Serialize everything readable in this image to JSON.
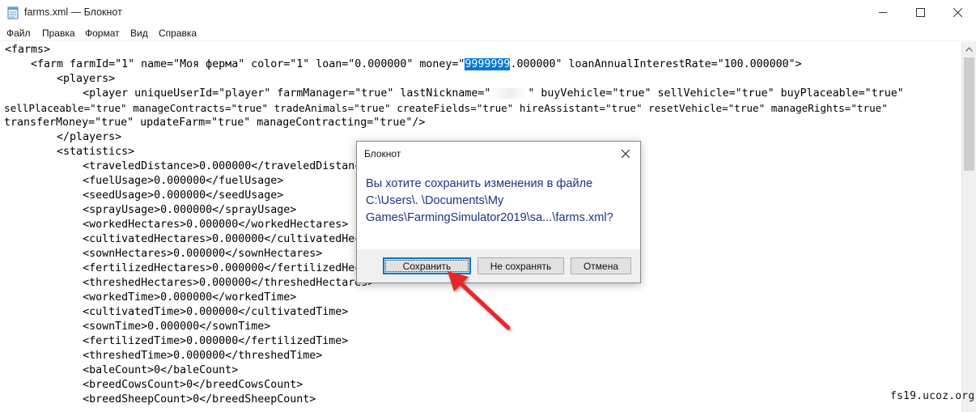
{
  "window": {
    "title": "farms.xml — Блокнот",
    "icon": "notepad-icon",
    "controls": [
      "minimize-icon",
      "maximize-icon",
      "close-icon"
    ]
  },
  "menu": [
    "Файл",
    "Правка",
    "Формат",
    "Вид",
    "Справка"
  ],
  "editor": {
    "lines": [
      "<farms>",
      "    <farm farmId=\"1\" name=\"Моя ферма\" color=\"1\" loan=\"0.000000\" money=\"",
      "        <players>",
      "            <player uniqueUserId=\"player\" farmManager=\"true\" lastNickname=\"",
      "sellPlaceable=\"true\" manageContracts=\"true\" tradeAnimals=\"true\" createFields=\"true\" hireAssistant=\"true\" resetVehicle=\"true\" manageRights=\"true\"",
      "transferMoney=\"true\" updateFarm=\"true\" manageContracting=\"true\"/>",
      "        </players>",
      "        <statistics>",
      "            <traveledDistance>0.000000</traveledDistance>",
      "            <fuelUsage>0.000000</fuelUsage>",
      "            <seedUsage>0.000000</seedUsage>",
      "            <sprayUsage>0.000000</sprayUsage>",
      "            <workedHectares>0.000000</workedHectares>",
      "            <cultivatedHectares>0.000000</cultivatedHectares>",
      "            <sownHectares>0.000000</sownHectares>",
      "            <fertilizedHectares>0.000000</fertilizedHectares>",
      "            <threshedHectares>0.000000</threshedHectares>",
      "            <workedTime>0.000000</workedTime>",
      "            <cultivatedTime>0.000000</cultivatedTime>",
      "            <sownTime>0.000000</sownTime>",
      "            <fertilizedTime>0.000000</fertilizedTime>",
      "            <threshedTime>0.000000</threshedTime>",
      "            <baleCount>0</baleCount>",
      "            <breedCowsCount>0</breedCowsCount>",
      "            <breedSheepCount>0</breedSheepCount>"
    ],
    "selected_text": "9999999",
    "line2_rest": ".000000\" loanAnnualInterestRate=\"100.000000\">",
    "line4_rest": "\" buyVehicle=\"true\" sellVehicle=\"true\" buyPlaceable=\"true\"",
    "selection_color": "#0078d7"
  },
  "dialog": {
    "title": "Блокнот",
    "message": [
      "Вы хотите сохранить изменения в файле",
      "C:\\Users\\.        \\Documents\\My",
      "Games\\FarmingSimulator2019\\sa...\\farms.xml?"
    ],
    "message_color": "#1e3287",
    "buttons": {
      "save": "Сохранить",
      "dont_save": "Не сохранять",
      "cancel": "Отмена"
    },
    "default_button_color": "#0078d7"
  },
  "annotation": {
    "arrow_color": "#e8262a",
    "points_to": "save-button"
  },
  "watermark": "fs19.ucoz.org"
}
